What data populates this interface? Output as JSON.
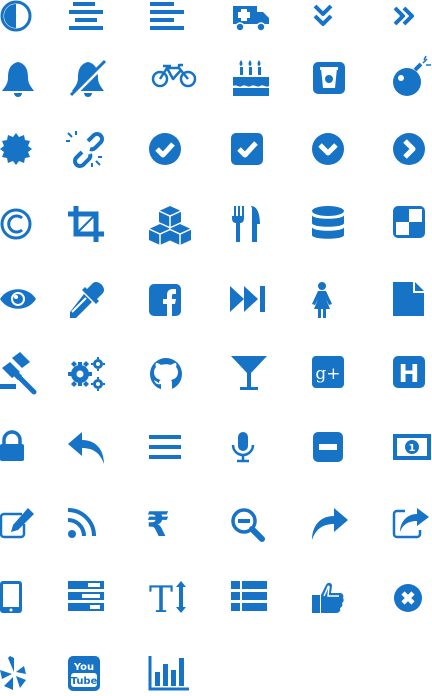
{
  "theme": {
    "icon_color": "#1673c6",
    "background": "#ffffff"
  },
  "icons": [
    {
      "name": "adjust-contrast-icon"
    },
    {
      "name": "align-center-icon"
    },
    {
      "name": "align-left-icon"
    },
    {
      "name": "ambulance-icon"
    },
    {
      "name": "angle-double-down-icon"
    },
    {
      "name": "angle-double-right-icon"
    },
    {
      "name": "bell-icon"
    },
    {
      "name": "bell-slash-icon"
    },
    {
      "name": "bicycle-icon"
    },
    {
      "name": "birthday-cake-icon"
    },
    {
      "name": "bitcoin-cup-icon"
    },
    {
      "name": "bomb-icon"
    },
    {
      "name": "certificate-icon"
    },
    {
      "name": "chain-broken-icon"
    },
    {
      "name": "check-circle-icon"
    },
    {
      "name": "check-square-icon"
    },
    {
      "name": "chevron-circle-down-icon"
    },
    {
      "name": "chevron-circle-right-icon"
    },
    {
      "name": "copyright-icon"
    },
    {
      "name": "crop-icon"
    },
    {
      "name": "cubes-icon"
    },
    {
      "name": "cutlery-icon"
    },
    {
      "name": "database-icon"
    },
    {
      "name": "delicious-icon"
    },
    {
      "name": "eye-icon"
    },
    {
      "name": "eyedropper-icon"
    },
    {
      "name": "facebook-square-icon"
    },
    {
      "name": "fast-forward-icon"
    },
    {
      "name": "female-icon"
    },
    {
      "name": "file-icon"
    },
    {
      "name": "gavel-icon"
    },
    {
      "name": "gears-icon"
    },
    {
      "name": "github-icon"
    },
    {
      "name": "glass-icon"
    },
    {
      "name": "google-plus-square-icon",
      "text": "g+"
    },
    {
      "name": "h-square-icon",
      "text": "H"
    },
    {
      "name": "lock-icon"
    },
    {
      "name": "mail-reply-icon"
    },
    {
      "name": "menu-bars-icon"
    },
    {
      "name": "microphone-icon"
    },
    {
      "name": "minus-square-icon"
    },
    {
      "name": "money-icon",
      "text": "1"
    },
    {
      "name": "edit-icon"
    },
    {
      "name": "rss-icon"
    },
    {
      "name": "rupee-icon",
      "text": "₹"
    },
    {
      "name": "search-minus-icon"
    },
    {
      "name": "share-icon"
    },
    {
      "name": "share-square-icon"
    },
    {
      "name": "tablet-icon"
    },
    {
      "name": "tasks-icon"
    },
    {
      "name": "text-height-icon",
      "text": "T"
    },
    {
      "name": "th-list-icon"
    },
    {
      "name": "thumbs-o-up-icon"
    },
    {
      "name": "times-circle-icon"
    },
    {
      "name": "yelp-icon"
    },
    {
      "name": "youtube-square-icon",
      "text1": "You",
      "text2": "Tube"
    },
    {
      "name": "bar-chart-icon"
    }
  ]
}
